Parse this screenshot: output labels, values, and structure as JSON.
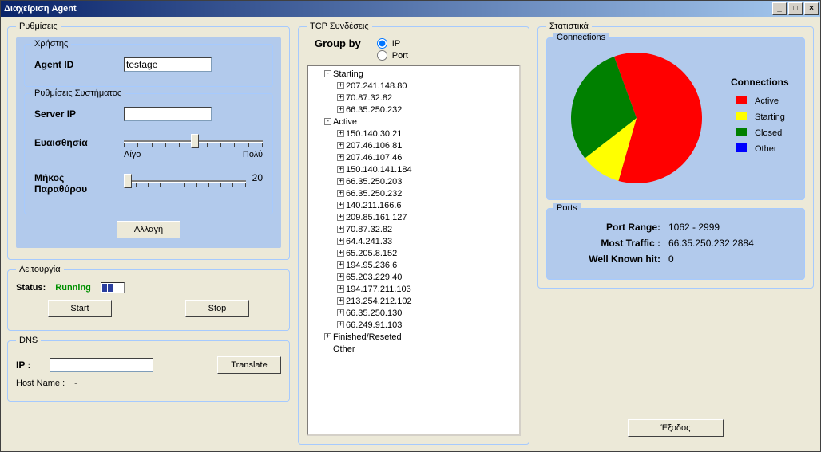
{
  "window_title": "Διαχείριση Agent",
  "settings": {
    "group_label": "Ρυθμίσεις",
    "user_group": "Χρήστης",
    "agent_id_label": "Agent ID",
    "agent_id_value": "testage",
    "sys_group": "Ρυθμίσεις Συστήματος",
    "server_ip_label": "Server IP",
    "server_ip_value": "",
    "sensitivity_label": "Ευαισθησία",
    "sensitivity_min": "Λίγο",
    "sensitivity_max": "Πολύ",
    "windowlen_label_l1": "Μήκος",
    "windowlen_label_l2": "Παραθύρου",
    "windowlen_value": "20",
    "apply_button": "Αλλαγή"
  },
  "operation": {
    "group_label": "Λειτουργία",
    "status_label": "Status:",
    "status_value": "Running",
    "start_button": "Start",
    "stop_button": "Stop"
  },
  "dns": {
    "group_label": "DNS",
    "ip_label": "IP :",
    "ip_value": "",
    "translate_button": "Translate",
    "hostname_label": "Host Name :",
    "hostname_value": "-"
  },
  "tcp": {
    "group_label": "TCP Συνδέσεις",
    "groupby_label": "Group by",
    "radio_ip": "IP",
    "radio_port": "Port",
    "tree": [
      {
        "label": "Starting",
        "expanded": true,
        "children": [
          "207.241.148.80",
          "70.87.32.82",
          "66.35.250.232"
        ]
      },
      {
        "label": "Active",
        "expanded": true,
        "children": [
          "150.140.30.21",
          "207.46.106.81",
          "207.46.107.46",
          "150.140.141.184",
          "66.35.250.203",
          "66.35.250.232",
          "140.211.166.6",
          "209.85.161.127",
          "70.87.32.82",
          "64.4.241.33",
          "65.205.8.152",
          "194.95.236.6",
          "65.203.229.40",
          "194.177.211.103",
          "213.254.212.102",
          "66.35.250.130",
          "66.249.91.103"
        ]
      },
      {
        "label": "Finished/Reseted",
        "expanded": false,
        "children": []
      },
      {
        "label": "Other",
        "expanded": false,
        "children": [],
        "no_expander": true
      }
    ]
  },
  "stats": {
    "group_label": "Στατιστικά",
    "connections_group": "Connections",
    "legend_title": "Connections",
    "legend": [
      {
        "name": "Active",
        "color": "#ff0000"
      },
      {
        "name": "Starting",
        "color": "#ffff00"
      },
      {
        "name": "Closed",
        "color": "#008000"
      },
      {
        "name": "Other",
        "color": "#0000ff"
      }
    ],
    "ports_group": "Ports",
    "port_range_label": "Port Range:",
    "port_range_value": "1062 - 2999",
    "most_traffic_label": "Most Traffic :",
    "most_traffic_value": "66.35.250.232 2884",
    "wellknown_label": "Well Known hit:",
    "wellknown_value": "0"
  },
  "exit_button": "Έξοδος",
  "chart_data": {
    "type": "pie",
    "title": "Connections",
    "series": [
      {
        "name": "Active",
        "value": 60,
        "color": "#ff0000"
      },
      {
        "name": "Starting",
        "value": 10,
        "color": "#ffff00"
      },
      {
        "name": "Closed",
        "value": 30,
        "color": "#008000"
      },
      {
        "name": "Other",
        "value": 0,
        "color": "#0000ff"
      }
    ]
  }
}
